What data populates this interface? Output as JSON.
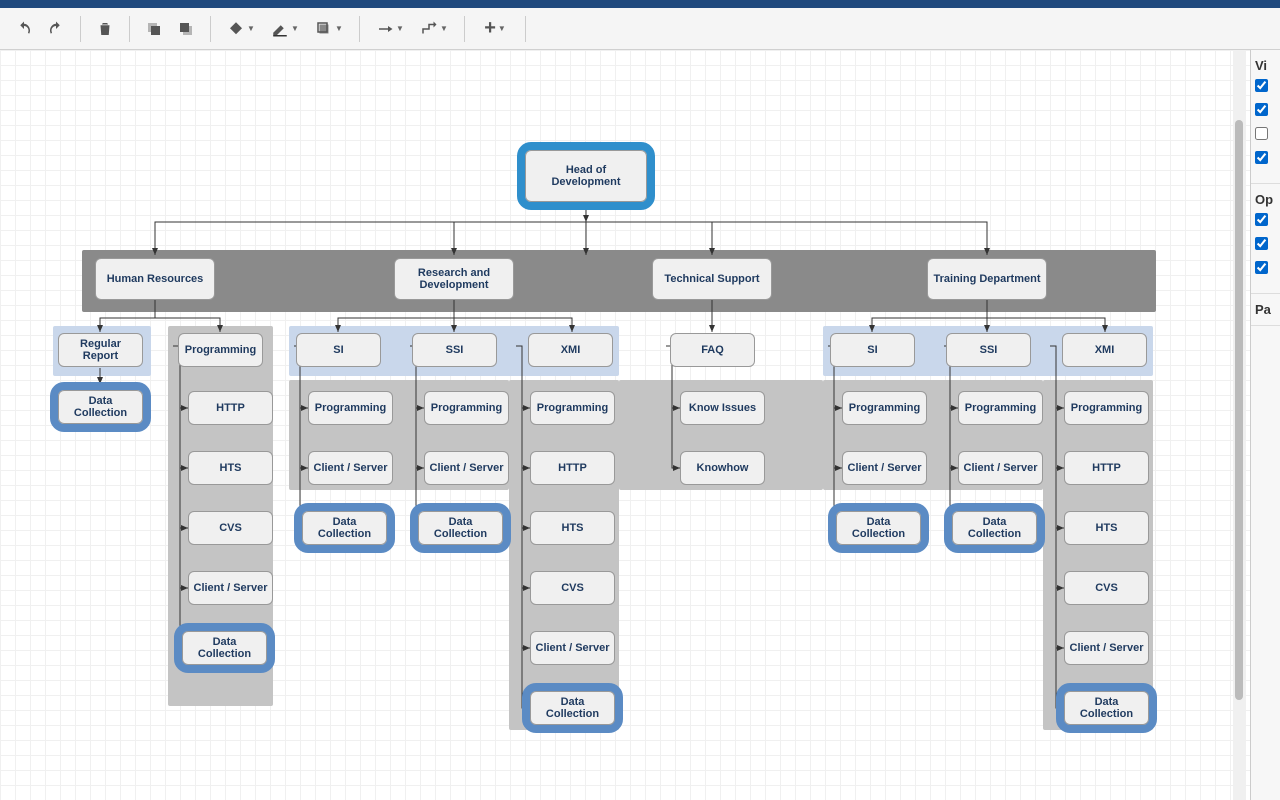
{
  "toolbar": {
    "undo": "undo",
    "redo": "redo",
    "delete": "delete",
    "front": "to-front",
    "back": "to-back",
    "fill": "fill-color",
    "line": "line-color",
    "shadow": "shadow",
    "conn1": "connection",
    "conn2": "waypoints",
    "add": "add"
  },
  "sidebar": {
    "section1": "Vi",
    "section2": "Op",
    "section3": "Pa",
    "checks": [
      true,
      true,
      false,
      true,
      true,
      true,
      true
    ]
  },
  "nodes": {
    "head": "Head of Development",
    "hr": "Human Resources",
    "rd": "Research and Development",
    "ts": "Technical Support",
    "td": "Training Department",
    "regreport": "Regular Report",
    "dc": "Data Collection",
    "prog": "Programming",
    "http": "HTTP",
    "hts": "HTS",
    "cvs": "CVS",
    "cs": "Client / Server",
    "si": "SI",
    "ssi": "SSI",
    "xmi": "XMI",
    "faq": "FAQ",
    "ki": "Know Issues",
    "kh": "Knowhow"
  }
}
